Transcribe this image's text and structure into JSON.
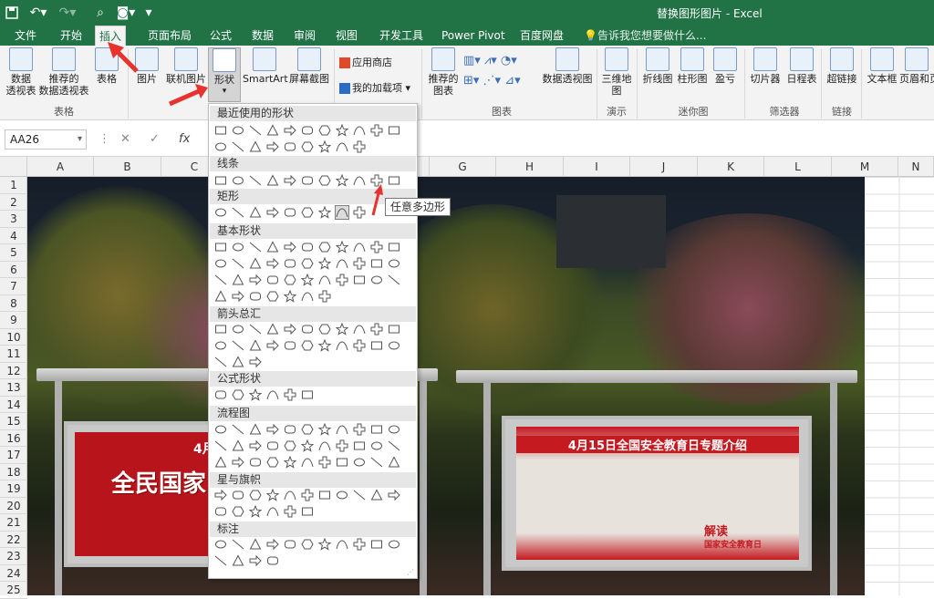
{
  "window_title": "替换图形图片 - Excel",
  "tabs": [
    "文件",
    "开始",
    "插入",
    "页面布局",
    "公式",
    "数据",
    "审阅",
    "视图",
    "开发工具",
    "Power Pivot",
    "百度网盘"
  ],
  "tell_me": "告诉我您想要做什么...",
  "ribbon": {
    "pivot_table": "数据\n透视表",
    "recommended_pivot": "推荐的\n数据透视表",
    "table": "表格",
    "tables_group": "表格",
    "picture": "图片",
    "online_picture": "联机图片",
    "shapes": "形状",
    "smartart": "SmartArt",
    "screenshot": "屏幕截图",
    "app_store": "应用商店",
    "my_addins": "我的加载项",
    "recommended_charts": "推荐的\n图表",
    "pivot_chart": "数据透视图",
    "charts_group": "图表",
    "map_3d": "三维地\n图",
    "tours_group": "演示",
    "line": "折线图",
    "column": "柱形图",
    "winloss": "盈亏",
    "sparklines_group": "迷你图",
    "slicer": "切片器",
    "timeline": "日程表",
    "filters_group": "筛选器",
    "hyperlink": "超链接",
    "links_group": "链接",
    "textbox": "文本框",
    "header_footer": "页眉和页"
  },
  "name_box": "AA26",
  "fx_label": "fx",
  "columns": [
    "A",
    "B",
    "C",
    "D",
    "E",
    "F",
    "G",
    "H",
    "I",
    "J",
    "K",
    "L",
    "M",
    "N"
  ],
  "rows": [
    "1",
    "2",
    "3",
    "4",
    "5",
    "6",
    "7",
    "8",
    "9",
    "10",
    "11",
    "12",
    "13",
    "14",
    "15",
    "16",
    "17",
    "18",
    "19",
    "20",
    "21",
    "22",
    "23",
    "24",
    "25"
  ],
  "shapes_menu": {
    "sections": [
      "最近使用的形状",
      "线条",
      "矩形",
      "基本形状",
      "箭头总汇",
      "公式形状",
      "流程图",
      "星与旗帜",
      "标注"
    ]
  },
  "tooltip": "任意多边形",
  "poster_left": {
    "heading": "4月",
    "title": "全民国家"
  },
  "poster_right": {
    "title": "4月15日全国安全教育日专题介绍",
    "tag": "解读",
    "sub": "国家安全教育日"
  },
  "colors": {
    "accent": "#217346",
    "ribbon_bg": "#f3f3f3",
    "poster_red": "#b7141b",
    "arrow_red": "#e8322e"
  }
}
